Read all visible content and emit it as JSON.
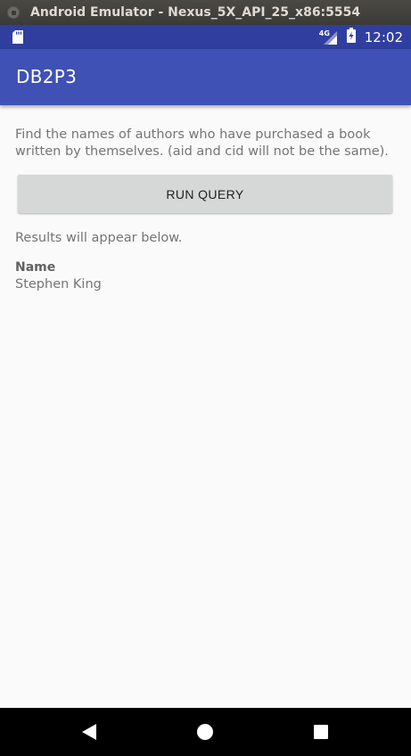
{
  "window": {
    "title": "Android Emulator - Nexus_5X_API_25_x86:5554"
  },
  "status_bar": {
    "network_label": "4G",
    "time": "12:02"
  },
  "app_bar": {
    "title": "DB2P3"
  },
  "main": {
    "description": "Find the names of authors who have purchased a book written by themselves. (aid and cid will not be the same).",
    "run_button_label": "RUN QUERY",
    "results_note": "Results will appear below.",
    "results": {
      "column_header": "Name",
      "rows": [
        "Stephen King"
      ]
    }
  },
  "nav_bar": {
    "back": "back-icon",
    "home": "home-icon",
    "recents": "recents-icon"
  },
  "colors": {
    "status_bar": "#303f9f",
    "app_bar": "#3f51b5",
    "button": "#d6d7d7"
  }
}
